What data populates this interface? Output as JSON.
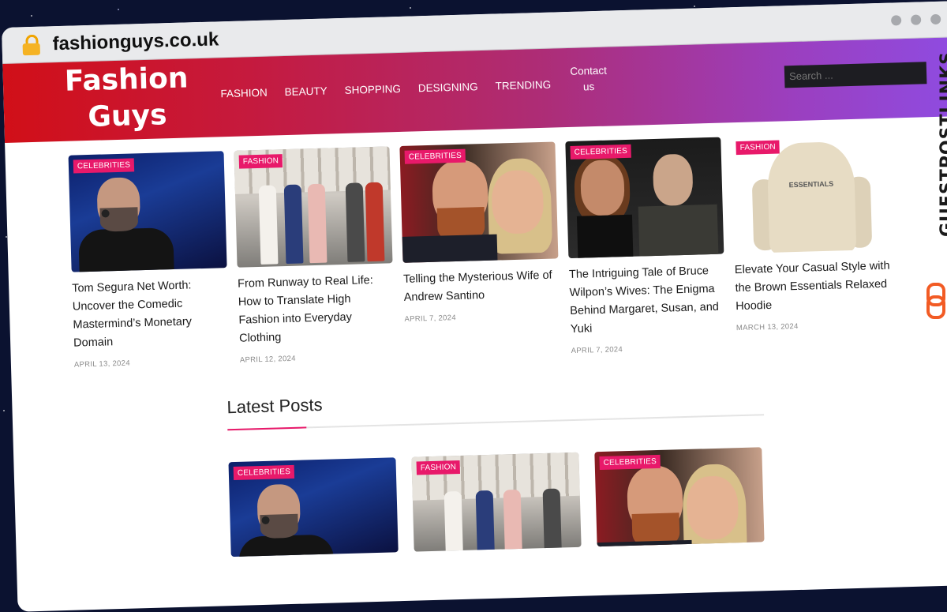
{
  "browser": {
    "url": "fashionguys.co.uk"
  },
  "site": {
    "logo_line1": "Fashion",
    "logo_line2": "Guys",
    "nav": [
      "FASHION",
      "BEAUTY",
      "SHOPPING",
      "DESIGNING",
      "TRENDING"
    ],
    "nav_contact_line1": "Contact",
    "nav_contact_line2": "us",
    "search_placeholder": "Search ..."
  },
  "featured": [
    {
      "category": "CELEBRITIES",
      "title": "Tom Segura Net Worth: Uncover the Comedic Mastermind’s Monetary Domain",
      "date": "APRIL 13, 2024"
    },
    {
      "category": "FASHION",
      "title": "From Runway to Real Life: How to Translate High Fashion into Everyday Clothing",
      "date": "APRIL 12, 2024"
    },
    {
      "category": "CELEBRITIES",
      "title": "Telling the Mysterious Wife of Andrew Santino",
      "date": "APRIL 7, 2024"
    },
    {
      "category": "CELEBRITIES",
      "title": "The Intriguing Tale of Bruce Wilpon’s Wives: The Enigma Behind Margaret, Susan, and Yuki",
      "date": "APRIL 7, 2024"
    },
    {
      "category": "FASHION",
      "title": "Elevate Your Casual Style with the Brown Essentials Relaxed Hoodie",
      "date": "MARCH 13, 2024",
      "image_text": "ESSENTIALS"
    }
  ],
  "latest": {
    "heading": "Latest Posts",
    "posts": [
      {
        "category": "CELEBRITIES"
      },
      {
        "category": "FASHION"
      },
      {
        "category": "CELEBRITIES"
      }
    ]
  },
  "watermark": {
    "text": "GUESTPOSTLINKS"
  },
  "colors": {
    "header_start": "#d10f18",
    "header_end": "#8c4ee8",
    "badge": "#e8196a",
    "watermark_icon": "#f25b24"
  }
}
